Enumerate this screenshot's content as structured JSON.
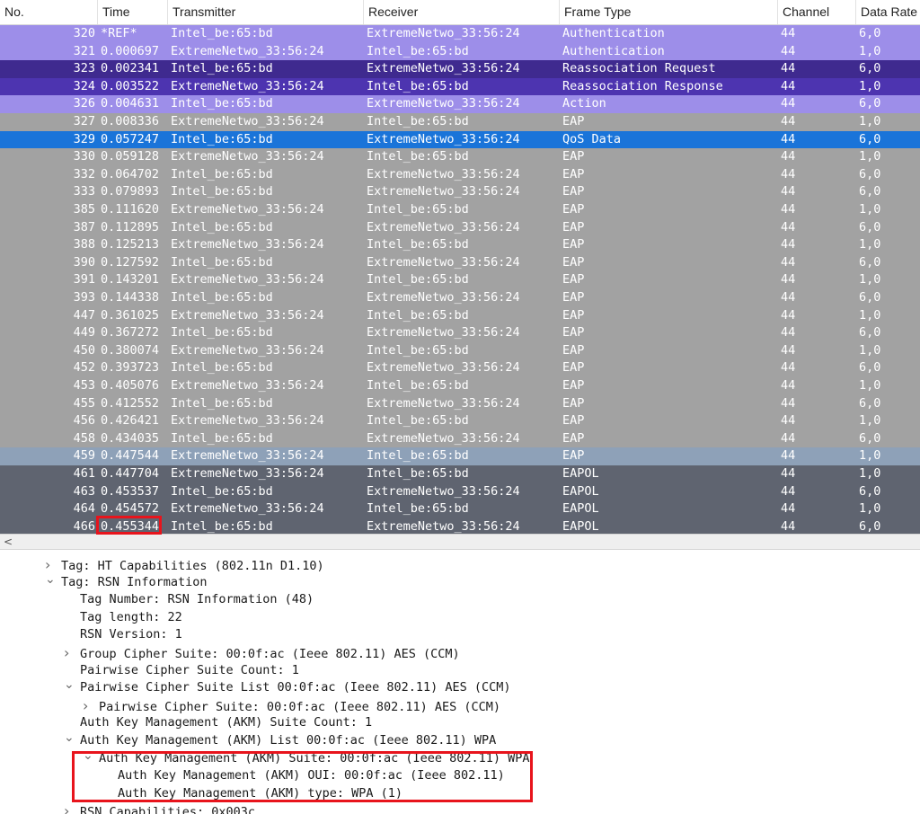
{
  "columns": [
    "No.",
    "Time",
    "Transmitter",
    "Receiver",
    "Frame Type",
    "Channel",
    "Data Rate"
  ],
  "colors": {
    "lavender": "#9d8ee9",
    "purple": "#3f2a8f",
    "indigo": "#4d34b0",
    "lightgray": "#a2a2a2",
    "selected": "#1a74d9",
    "steel": "#8ea1b8",
    "dark": "#5f6470"
  },
  "packets": [
    {
      "no": "320",
      "time": "*REF*",
      "tx": "Intel_be:65:bd",
      "rx": "ExtremeNetwo_33:56:24",
      "ft": "Authentication",
      "ch": "44",
      "dr": "6,0",
      "style": "lavender"
    },
    {
      "no": "321",
      "time": "0.000697",
      "tx": "ExtremeNetwo_33:56:24",
      "rx": "Intel_be:65:bd",
      "ft": "Authentication",
      "ch": "44",
      "dr": "1,0",
      "style": "lavender"
    },
    {
      "no": "323",
      "time": "0.002341",
      "tx": "Intel_be:65:bd",
      "rx": "ExtremeNetwo_33:56:24",
      "ft": "Reassociation Request",
      "ch": "44",
      "dr": "6,0",
      "style": "purple"
    },
    {
      "no": "324",
      "time": "0.003522",
      "tx": "ExtremeNetwo_33:56:24",
      "rx": "Intel_be:65:bd",
      "ft": "Reassociation Response",
      "ch": "44",
      "dr": "1,0",
      "style": "indigo"
    },
    {
      "no": "326",
      "time": "0.004631",
      "tx": "Intel_be:65:bd",
      "rx": "ExtremeNetwo_33:56:24",
      "ft": "Action",
      "ch": "44",
      "dr": "6,0",
      "style": "lavender"
    },
    {
      "no": "327",
      "time": "0.008336",
      "tx": "ExtremeNetwo_33:56:24",
      "rx": "Intel_be:65:bd",
      "ft": "EAP",
      "ch": "44",
      "dr": "1,0",
      "style": "lightgray"
    },
    {
      "no": "329",
      "time": "0.057247",
      "tx": "Intel_be:65:bd",
      "rx": "ExtremeNetwo_33:56:24",
      "ft": "QoS Data",
      "ch": "44",
      "dr": "6,0",
      "style": "selected"
    },
    {
      "no": "330",
      "time": "0.059128",
      "tx": "ExtremeNetwo_33:56:24",
      "rx": "Intel_be:65:bd",
      "ft": "EAP",
      "ch": "44",
      "dr": "1,0",
      "style": "lightgray"
    },
    {
      "no": "332",
      "time": "0.064702",
      "tx": "Intel_be:65:bd",
      "rx": "ExtremeNetwo_33:56:24",
      "ft": "EAP",
      "ch": "44",
      "dr": "6,0",
      "style": "lightgray"
    },
    {
      "no": "333",
      "time": "0.079893",
      "tx": "Intel_be:65:bd",
      "rx": "ExtremeNetwo_33:56:24",
      "ft": "EAP",
      "ch": "44",
      "dr": "6,0",
      "style": "lightgray"
    },
    {
      "no": "385",
      "time": "0.111620",
      "tx": "ExtremeNetwo_33:56:24",
      "rx": "Intel_be:65:bd",
      "ft": "EAP",
      "ch": "44",
      "dr": "1,0",
      "style": "lightgray"
    },
    {
      "no": "387",
      "time": "0.112895",
      "tx": "Intel_be:65:bd",
      "rx": "ExtremeNetwo_33:56:24",
      "ft": "EAP",
      "ch": "44",
      "dr": "6,0",
      "style": "lightgray"
    },
    {
      "no": "388",
      "time": "0.125213",
      "tx": "ExtremeNetwo_33:56:24",
      "rx": "Intel_be:65:bd",
      "ft": "EAP",
      "ch": "44",
      "dr": "1,0",
      "style": "lightgray"
    },
    {
      "no": "390",
      "time": "0.127592",
      "tx": "Intel_be:65:bd",
      "rx": "ExtremeNetwo_33:56:24",
      "ft": "EAP",
      "ch": "44",
      "dr": "6,0",
      "style": "lightgray"
    },
    {
      "no": "391",
      "time": "0.143201",
      "tx": "ExtremeNetwo_33:56:24",
      "rx": "Intel_be:65:bd",
      "ft": "EAP",
      "ch": "44",
      "dr": "1,0",
      "style": "lightgray"
    },
    {
      "no": "393",
      "time": "0.144338",
      "tx": "Intel_be:65:bd",
      "rx": "ExtremeNetwo_33:56:24",
      "ft": "EAP",
      "ch": "44",
      "dr": "6,0",
      "style": "lightgray"
    },
    {
      "no": "447",
      "time": "0.361025",
      "tx": "ExtremeNetwo_33:56:24",
      "rx": "Intel_be:65:bd",
      "ft": "EAP",
      "ch": "44",
      "dr": "1,0",
      "style": "lightgray"
    },
    {
      "no": "449",
      "time": "0.367272",
      "tx": "Intel_be:65:bd",
      "rx": "ExtremeNetwo_33:56:24",
      "ft": "EAP",
      "ch": "44",
      "dr": "6,0",
      "style": "lightgray"
    },
    {
      "no": "450",
      "time": "0.380074",
      "tx": "ExtremeNetwo_33:56:24",
      "rx": "Intel_be:65:bd",
      "ft": "EAP",
      "ch": "44",
      "dr": "1,0",
      "style": "lightgray"
    },
    {
      "no": "452",
      "time": "0.393723",
      "tx": "Intel_be:65:bd",
      "rx": "ExtremeNetwo_33:56:24",
      "ft": "EAP",
      "ch": "44",
      "dr": "6,0",
      "style": "lightgray"
    },
    {
      "no": "453",
      "time": "0.405076",
      "tx": "ExtremeNetwo_33:56:24",
      "rx": "Intel_be:65:bd",
      "ft": "EAP",
      "ch": "44",
      "dr": "1,0",
      "style": "lightgray"
    },
    {
      "no": "455",
      "time": "0.412552",
      "tx": "Intel_be:65:bd",
      "rx": "ExtremeNetwo_33:56:24",
      "ft": "EAP",
      "ch": "44",
      "dr": "6,0",
      "style": "lightgray"
    },
    {
      "no": "456",
      "time": "0.426421",
      "tx": "ExtremeNetwo_33:56:24",
      "rx": "Intel_be:65:bd",
      "ft": "EAP",
      "ch": "44",
      "dr": "1,0",
      "style": "lightgray"
    },
    {
      "no": "458",
      "time": "0.434035",
      "tx": "Intel_be:65:bd",
      "rx": "ExtremeNetwo_33:56:24",
      "ft": "EAP",
      "ch": "44",
      "dr": "6,0",
      "style": "lightgray"
    },
    {
      "no": "459",
      "time": "0.447544",
      "tx": "ExtremeNetwo_33:56:24",
      "rx": "Intel_be:65:bd",
      "ft": "EAP",
      "ch": "44",
      "dr": "1,0",
      "style": "steel"
    },
    {
      "no": "461",
      "time": "0.447704",
      "tx": "ExtremeNetwo_33:56:24",
      "rx": "Intel_be:65:bd",
      "ft": "EAPOL",
      "ch": "44",
      "dr": "1,0",
      "style": "dark"
    },
    {
      "no": "463",
      "time": "0.453537",
      "tx": "Intel_be:65:bd",
      "rx": "ExtremeNetwo_33:56:24",
      "ft": "EAPOL",
      "ch": "44",
      "dr": "6,0",
      "style": "dark"
    },
    {
      "no": "464",
      "time": "0.454572",
      "tx": "ExtremeNetwo_33:56:24",
      "rx": "Intel_be:65:bd",
      "ft": "EAPOL",
      "ch": "44",
      "dr": "1,0",
      "style": "dark"
    },
    {
      "no": "466",
      "time": "0.455344",
      "tx": "Intel_be:65:bd",
      "rx": "ExtremeNetwo_33:56:24",
      "ft": "EAPOL",
      "ch": "44",
      "dr": "6,0",
      "style": "dark"
    }
  ],
  "scroll_left_arrow": "<",
  "tree": [
    {
      "text": "Tag: HT Capabilities (802.11n D1.10)",
      "level": 0,
      "chevron": "right"
    },
    {
      "text": "Tag: RSN Information",
      "level": 0,
      "chevron": "down"
    },
    {
      "text": "Tag Number: RSN Information (48)",
      "level": 1,
      "chevron": "none"
    },
    {
      "text": "Tag length: 22",
      "level": 1,
      "chevron": "none"
    },
    {
      "text": "RSN Version: 1",
      "level": 1,
      "chevron": "none"
    },
    {
      "text": "Group Cipher Suite: 00:0f:ac (Ieee 802.11) AES (CCM)",
      "level": 1,
      "chevron": "right"
    },
    {
      "text": "Pairwise Cipher Suite Count: 1",
      "level": 1,
      "chevron": "none"
    },
    {
      "text": "Pairwise Cipher Suite List 00:0f:ac (Ieee 802.11) AES (CCM)",
      "level": 1,
      "chevron": "down"
    },
    {
      "text": "Pairwise Cipher Suite: 00:0f:ac (Ieee 802.11) AES (CCM)",
      "level": 2,
      "chevron": "right"
    },
    {
      "text": "Auth Key Management (AKM) Suite Count: 1",
      "level": 1,
      "chevron": "none"
    },
    {
      "text": "Auth Key Management (AKM) List 00:0f:ac (Ieee 802.11) WPA",
      "level": 1,
      "chevron": "down"
    },
    {
      "text": "Auth Key Management (AKM) Suite: 00:0f:ac (Ieee 802.11) WPA",
      "level": 2,
      "chevron": "down"
    },
    {
      "text": "Auth Key Management (AKM) OUI: 00:0f:ac (Ieee 802.11)",
      "level": 3,
      "chevron": "none"
    },
    {
      "text": "Auth Key Management (AKM) type: WPA (1)",
      "level": 3,
      "chevron": "none"
    },
    {
      "text": "RSN Capabilities: 0x003c",
      "level": 1,
      "chevron": "right"
    }
  ]
}
